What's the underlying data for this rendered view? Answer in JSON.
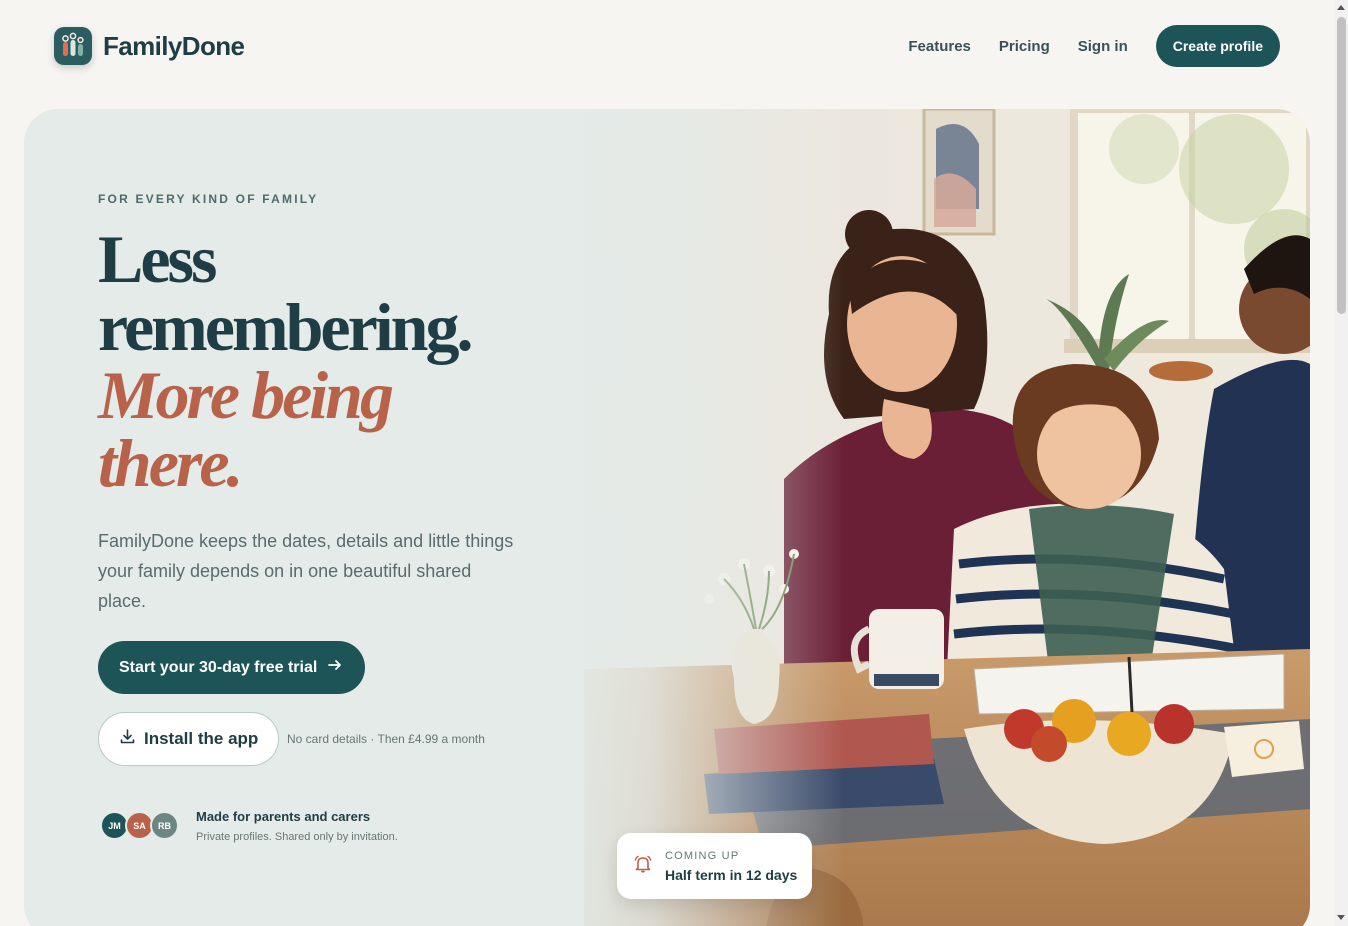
{
  "header": {
    "brand_name": "FamilyDone",
    "nav": {
      "features": "Features",
      "pricing": "Pricing",
      "sign_in": "Sign in"
    },
    "cta": "Create profile"
  },
  "hero": {
    "eyebrow": "FOR EVERY KIND OF FAMILY",
    "headline": {
      "line1": "Less",
      "line2": "remembering.",
      "accent1": "More being",
      "accent2": "there."
    },
    "lede": "FamilyDone keeps the dates, details and little things your family depends on in one beautiful shared place.",
    "primary_cta": "Start your 30-day free trial",
    "secondary_cta": "Install the app",
    "fine_print": "No card details · Then £4.99 a month",
    "avatars": [
      "JM",
      "SA",
      "RB"
    ],
    "trust_title": "Made for parents and carers",
    "trust_sub": "Private profiles. Shared only by invitation."
  },
  "coming_up": {
    "eyebrow": "COMING UP",
    "title": "Half term in 12 days"
  },
  "icons": {
    "logo": "family-logo-icon",
    "arrow": "arrow-right-icon",
    "download": "download-icon",
    "bell": "bell-icon"
  },
  "colors": {
    "brand": "#1d5457",
    "accent": "#b9624a",
    "hero_bg": "#e4ebe8",
    "page_bg": "#f6f5f1"
  }
}
